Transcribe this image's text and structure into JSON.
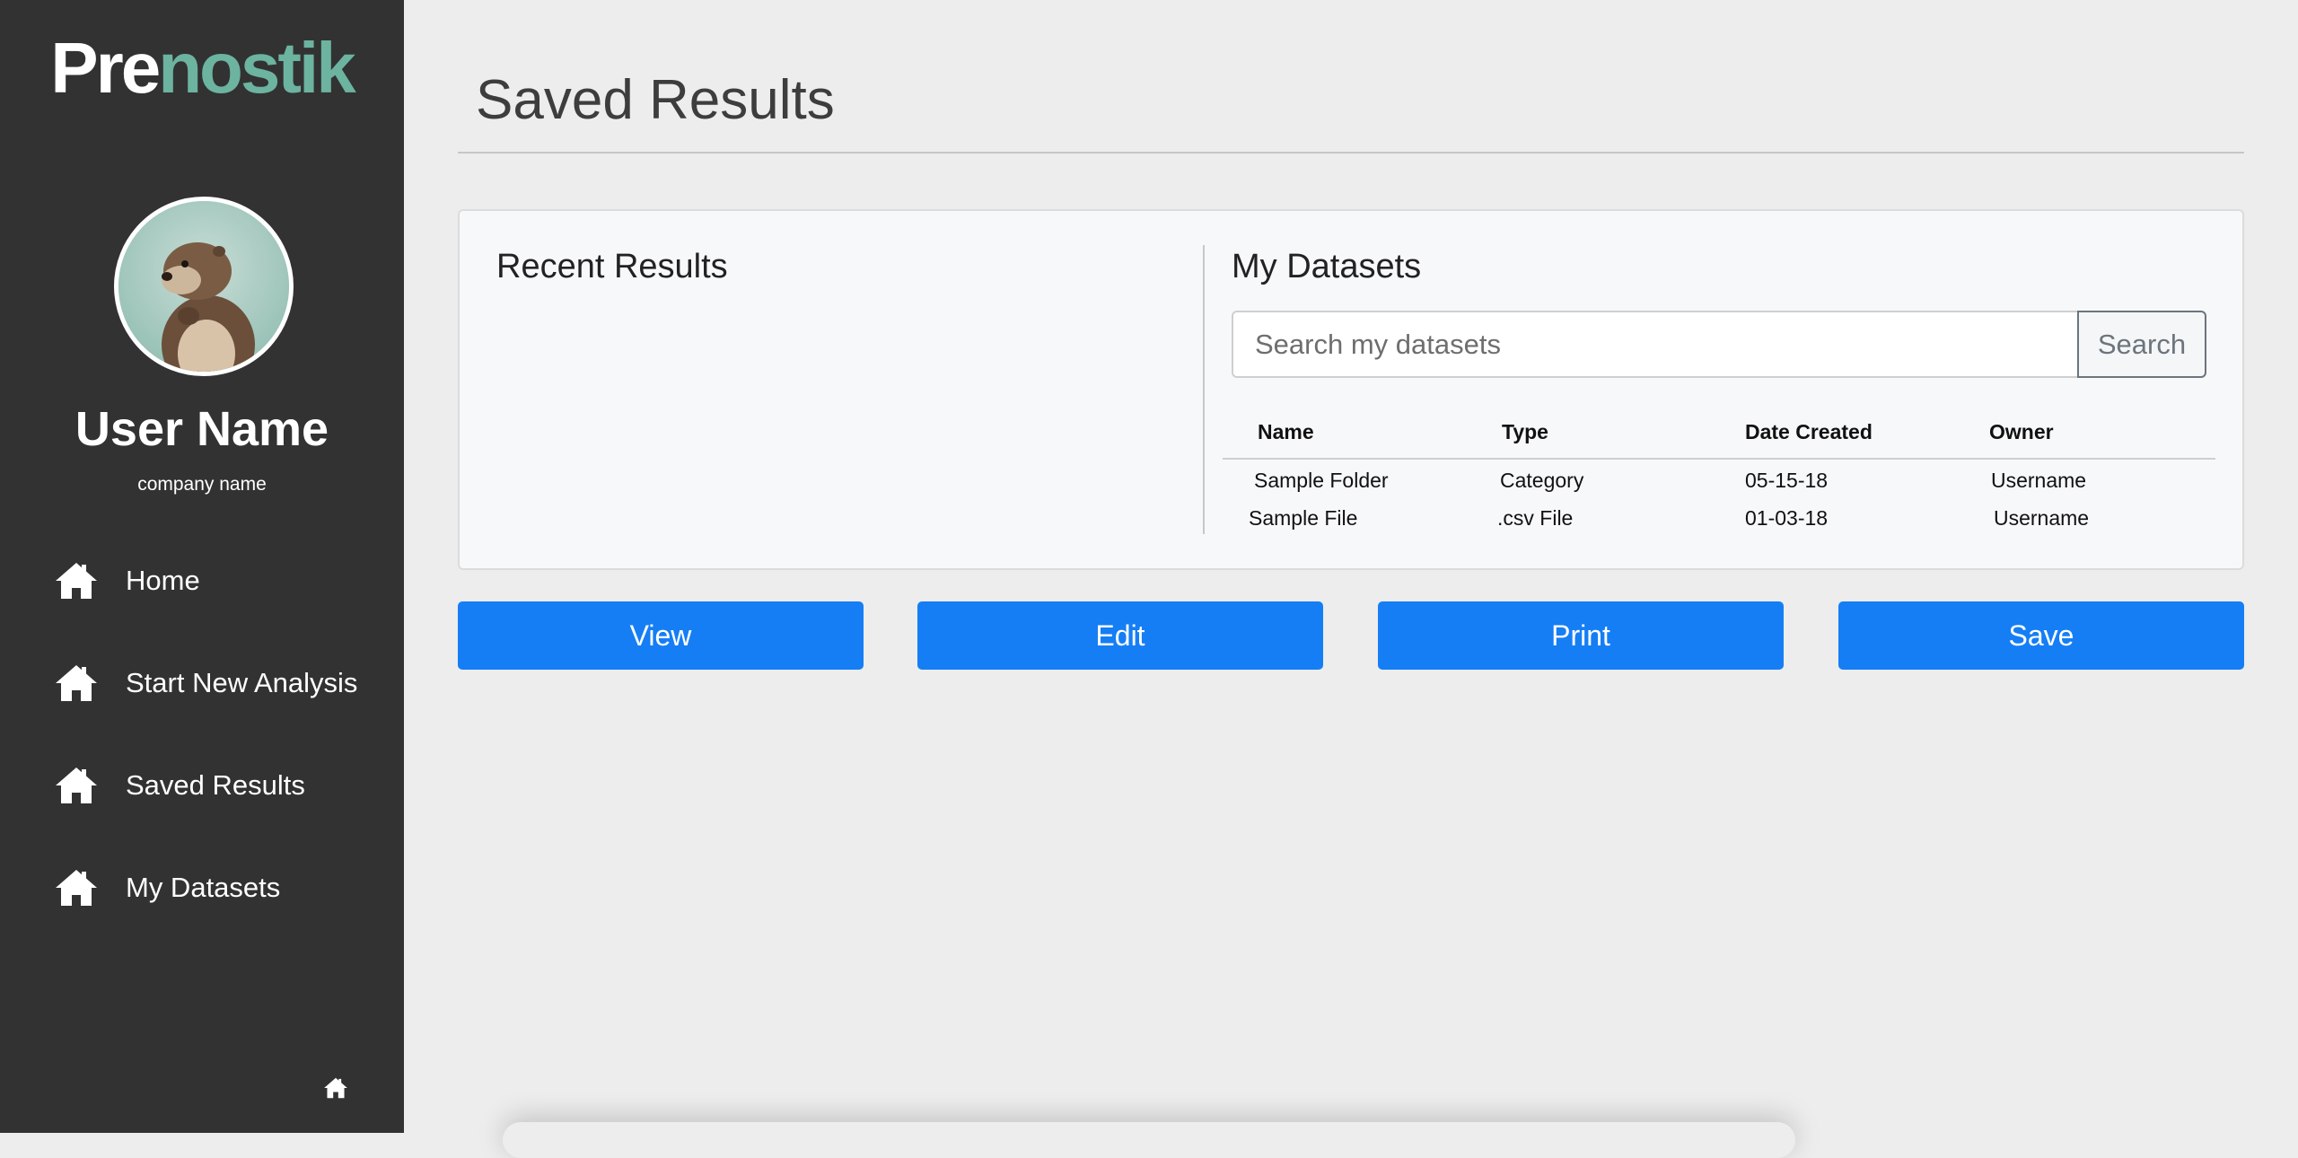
{
  "brand": {
    "prefix": "Pre",
    "suffix": "nostik"
  },
  "user": {
    "name": "User Name",
    "company": "company name"
  },
  "nav": {
    "items": [
      {
        "label": "Home",
        "icon": "home-icon"
      },
      {
        "label": "Start New Analysis",
        "icon": "home-icon"
      },
      {
        "label": "Saved Results",
        "icon": "home-icon"
      },
      {
        "label": "My Datasets",
        "icon": "home-icon"
      }
    ]
  },
  "page": {
    "title": "Saved Results"
  },
  "recent": {
    "title": "Recent Results"
  },
  "datasets": {
    "title": "My Datasets",
    "search": {
      "placeholder": "Search my datasets",
      "button": "Search"
    },
    "columns": [
      "Name",
      "Type",
      "Date Created",
      "Owner"
    ],
    "rows": [
      [
        "Sample Folder",
        "Category",
        "05-15-18",
        "Username"
      ],
      [
        "Sample File",
        ".csv File",
        "01-03-18",
        "Username"
      ]
    ]
  },
  "actions": {
    "view": "View",
    "edit": "Edit",
    "print": "Print",
    "save": "Save"
  },
  "colors": {
    "sidebar": "#323232",
    "accent": "#6cb3a0",
    "button": "#157ef5"
  }
}
